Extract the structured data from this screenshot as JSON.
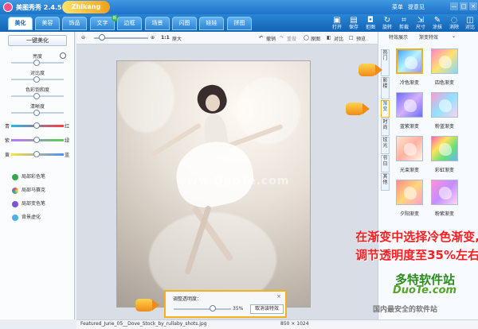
{
  "window": {
    "title": "美图秀秀 2.4.5",
    "brand": "Zhikang",
    "menu": [
      "菜单",
      "提意见"
    ],
    "controls": [
      "—",
      "□",
      "×"
    ]
  },
  "tabs": [
    "美化",
    "美容",
    "饰品",
    "文字",
    "边框",
    "场景",
    "闪图",
    "娃娃",
    "拼图"
  ],
  "tab_badge": "新",
  "toolbar": [
    "打开",
    "保存",
    "拒图",
    "旋转",
    "剪裁",
    "尺寸",
    "涂抹",
    "消除",
    "对比"
  ],
  "left_panel": {
    "one_click": "一键美化",
    "sliders": [
      "亮度",
      "对比度",
      "色彩饱和度",
      "清晰度"
    ],
    "color_labels": [
      "青",
      "红",
      "紫",
      "绿",
      "黄",
      "蓝"
    ],
    "tools": [
      "局部彩色笔",
      "局部马赛克",
      "局部变色笔",
      "背景虚化"
    ]
  },
  "top_controls": {
    "ratio": "1:1",
    "original": "原大",
    "undo": "撤销",
    "redo": "重做",
    "original_image": "原图",
    "compare": "对比",
    "preview": "预览"
  },
  "right_panel": {
    "tabs": [
      "特效展示",
      "渐变特效"
    ],
    "vertical_tabs": [
      "热门",
      "影楼",
      "渐变",
      "时尚",
      "炫光",
      "节日",
      "其他"
    ],
    "effects": [
      "冷色渐变",
      "四色渐变",
      "蓝紫渐变",
      "粉蓝渐变",
      "光束渐变",
      "彩虹渐变",
      "夕阳渐变",
      "粉紫渐变"
    ]
  },
  "transparency_panel": {
    "label": "调整透明度：",
    "value": "35%",
    "button": "取消该特效"
  },
  "status": {
    "filename": "Featured_June_05__Dove_Stock_by_rullaby_shots.jpg",
    "dimensions": "850 × 1024"
  },
  "annotation": {
    "line1": "在渐变中选择冷色渐变,",
    "line2": "调节透明度至35%左右"
  },
  "watermarks": {
    "photo": "www.DuoTe.com",
    "logo": "多特软件站",
    "domain": "DuoTe.com",
    "tagline": "国内最安全的软件站"
  },
  "colors": {
    "accent": "#1f72c8",
    "highlight": "#f4b11e",
    "annotation": "#ff1d22",
    "site_green": "#2d8a1f"
  }
}
